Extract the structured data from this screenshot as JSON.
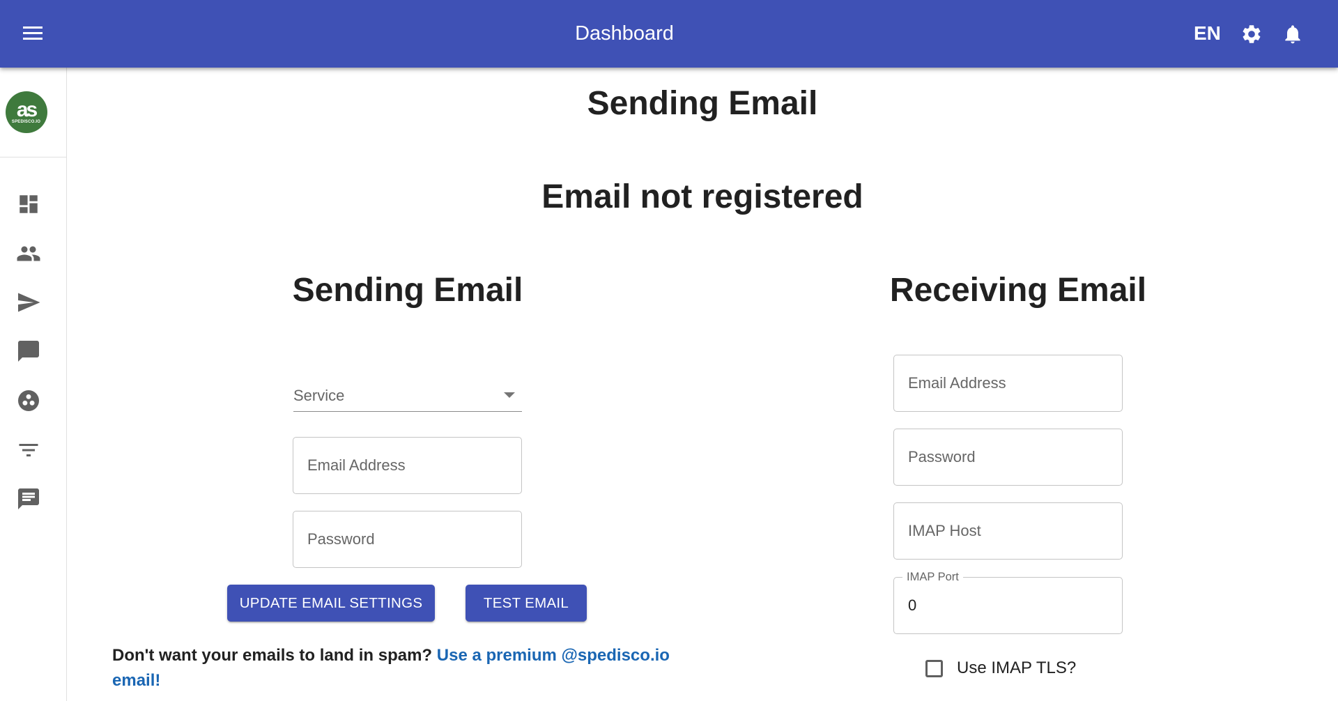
{
  "appbar": {
    "title": "Dashboard",
    "language": "EN",
    "icons": [
      "menu-icon",
      "gear-icon",
      "bell-icon"
    ],
    "color": "#3f51b5"
  },
  "sidebar": {
    "logo_mark": "as",
    "logo_text": "SPEDISCO.IO",
    "logo_color": "#3f7a3d",
    "items": [
      {
        "icon": "dashboard-icon"
      },
      {
        "icon": "people-icon"
      },
      {
        "icon": "send-icon"
      },
      {
        "icon": "chat-bubble-icon"
      },
      {
        "icon": "workspaces-icon"
      },
      {
        "icon": "filter-list-icon"
      },
      {
        "icon": "chat-icon"
      }
    ]
  },
  "main": {
    "page_title": "Sending Email",
    "status": "Email not registered",
    "sending": {
      "title": "Sending Email",
      "service_label": "Service",
      "service_value": "",
      "email_placeholder": "Email Address",
      "password_placeholder": "Password",
      "update_button": "UPDATE EMAIL SETTINGS",
      "test_button": "TEST EMAIL",
      "spam_text": "Don't want your emails to land in spam?",
      "spam_link": "Use a premium @spedisco.io email!"
    },
    "receiving": {
      "title": "Receiving Email",
      "email_placeholder": "Email Address",
      "password_placeholder": "Password",
      "imap_host_placeholder": "IMAP Host",
      "imap_port_label": "IMAP Port",
      "imap_port_value": "0",
      "tls_label": "Use IMAP TLS?",
      "tls_checked": false
    }
  }
}
